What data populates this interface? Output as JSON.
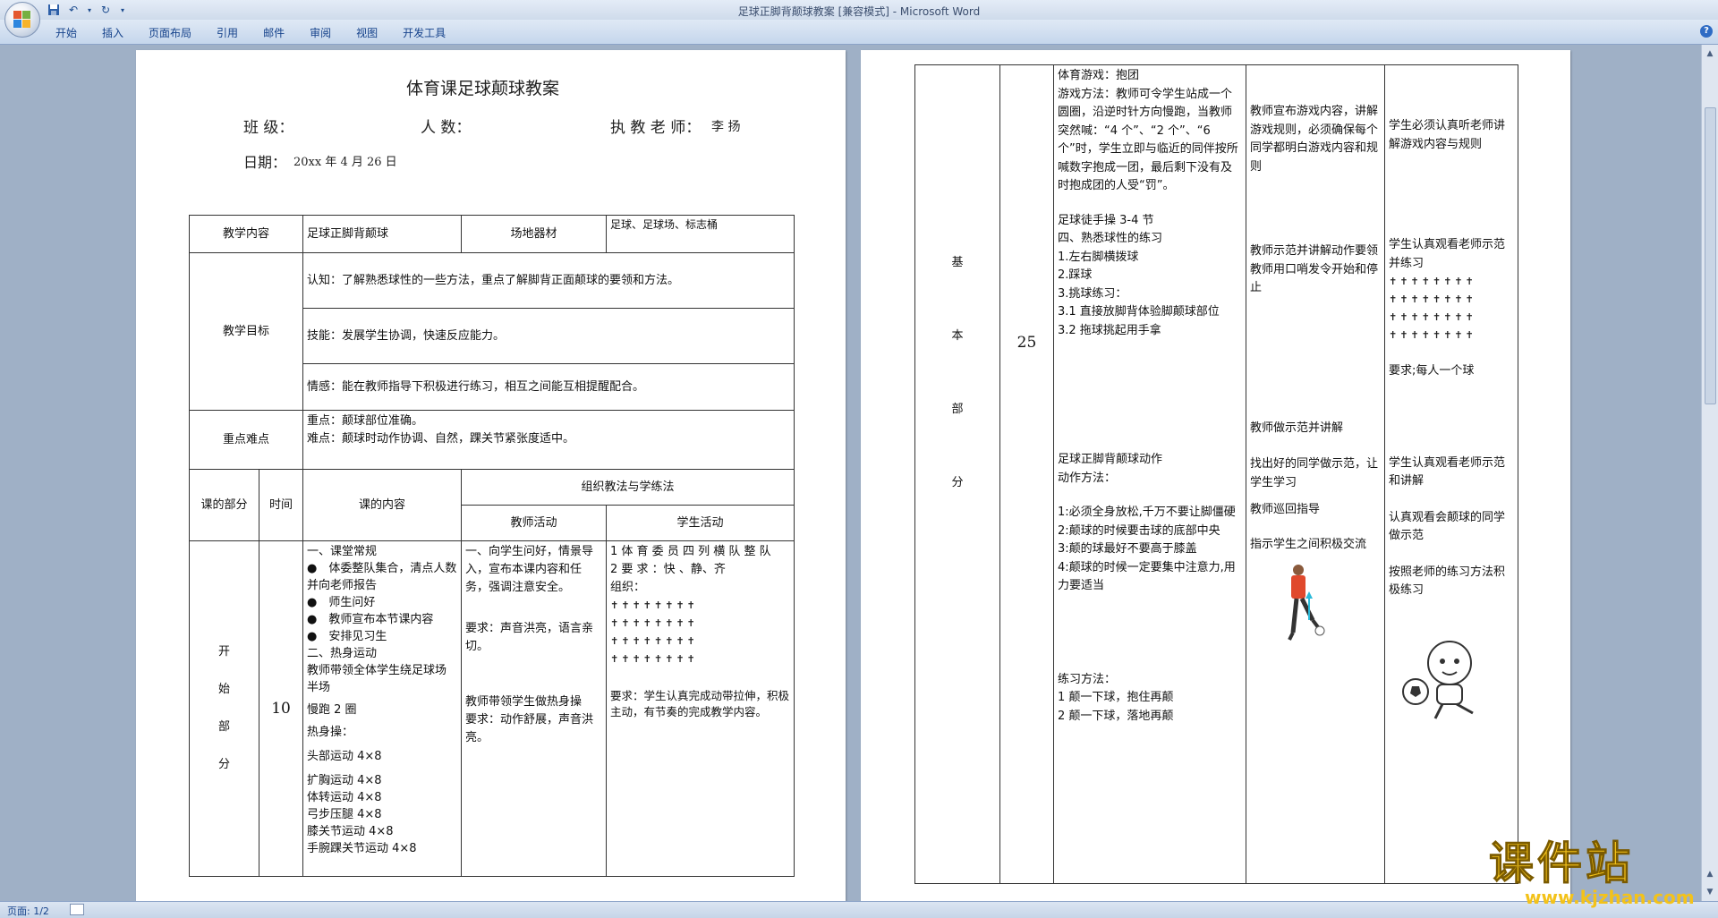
{
  "window": {
    "title": "足球正脚背颠球教案 [兼容模式] - Microsoft Word"
  },
  "ribbon": {
    "tabs": [
      "开始",
      "插入",
      "页面布局",
      "引用",
      "邮件",
      "审阅",
      "视图",
      "开发工具"
    ]
  },
  "status": {
    "page": "页面: 1/2"
  },
  "doc": {
    "title": "体育课足球颠球教案",
    "class_label": "班 级：",
    "count_label": "人 数：",
    "teacher_label": "执 教 老 师：",
    "teacher_name": "李 扬",
    "date_label": "日期：",
    "date_value": "20xx 年 4 月 26 日",
    "header": {
      "content_label": "教学内容",
      "content_value": "足球正脚背颠球",
      "venue_label": "场地器材",
      "venue_value": "足球、足球场、标志桶",
      "objectives_label": "教学目标",
      "objective_1": "认知：了解熟悉球性的一些方法，重点了解脚背正面颠球的要领和方法。",
      "objective_2": "技能：发展学生协调，快速反应能力。",
      "objective_3": "情感：能在教师指导下积极进行练习，相互之间能互相提醒配合。",
      "key_label": "重点难点",
      "key_1": "重点：颠球部位准确。",
      "key_2": "难点：颠球时动作协调、自然，踝关节紧张度适中。",
      "part_label": "课的部分",
      "time_label": "时间",
      "lesson_content_label": "课的内容",
      "org_label": "组织教法与学练法",
      "teacher_activity_label": "教师活动",
      "student_activity_label": "学生活动"
    },
    "start": {
      "part": [
        "开",
        "始",
        "部",
        "分"
      ],
      "time": "10",
      "content": [
        "一、课堂常规",
        "●　体委整队集合，清点人数并向老师报告",
        "●　师生问好",
        "●　教师宣布本节课内容",
        "●　安排见习生",
        "二、热身运动",
        "教师带领全体学生绕足球场半场",
        "慢跑 2 圈",
        "热身操：",
        "头部运动 4×8",
        "扩胸运动 4×8",
        "体转运动 4×8",
        "弓步压腿 4×8",
        "膝关节运动 4×8",
        "手腕踝关节运动 4×8"
      ],
      "teacher": [
        "一、向学生问好，情景导入，宣布本课内容和任务，强调注意安全。",
        "要求：声音洪亮，语言亲切。",
        "教师带领学生做热身操",
        "要求：动作舒展，声音洪亮。"
      ],
      "student": [
        "1 体 育 委 员 四 列 横 队 整 队",
        "2 要 求 ：快 、静、齐",
        "组织：",
        "要求：学生认真完成动带拉伸，积极主动，有节奏的完成教学内容。"
      ],
      "formation": "✝✝✝✝✝✝✝✝"
    },
    "basic": {
      "part": [
        "基",
        "本",
        "部",
        "分"
      ],
      "time": "25",
      "content": [
        "体育游戏：抱团",
        "游戏方法：教师可令学生站成一个圆圈，沿逆时针方向慢跑，当教师突然喊：“4 个”、“2 个”、“6 个”时，学生立即与临近的同伴按所喊数字抱成一团，最后剩下没有及时抱成团的人受“罚”。",
        "足球徒手操 3-4 节",
        "四、熟悉球性的练习",
        "1.左右脚横拨球",
        "2.踩球",
        "3.挑球练习：",
        "3.1 直接放脚背体验脚颠球部位",
        "3.2 拖球挑起用手拿",
        "足球正脚背颠球动作",
        "动作方法：",
        "1:必须全身放松,千万不要让脚僵硬",
        "2:颠球的时候要击球的底部中央",
        "3:颠的球最好不要高于膝盖",
        "4:颠球的时候一定要集中注意力,用力要适当",
        "练习方法：",
        "1 颠一下球，抱住再颠",
        "2 颠一下球，落地再颠"
      ],
      "teacher": [
        "教师宣布游戏内容，讲解游戏规则，必须确保每个同学都明白游戏内容和规则",
        "教师示范并讲解动作要领",
        "教师用口哨发令开始和停止",
        "教师做示范并讲解",
        "找出好的同学做示范，让学生学习",
        "教师巡回指导",
        "指示学生之间积极交流"
      ],
      "student": [
        "学生必须认真听老师讲解游戏内容与规则",
        "学生认真观看老师示范并练习",
        "要求;每人一个球",
        "学生认真观看老师示范和讲解",
        "认真观看会颠球的同学做示范",
        "按照老师的练习方法积极练习"
      ]
    }
  },
  "watermark": {
    "main": "课件站",
    "url": "www.kjzhan.com"
  },
  "colors": {
    "ribbon_text": "#15428b",
    "workspace": "#9fb0c6",
    "watermark": "#f3c21a"
  }
}
